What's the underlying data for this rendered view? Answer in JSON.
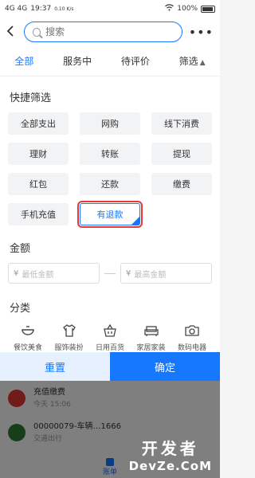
{
  "status": {
    "network": "4G 4G",
    "time": "19:37",
    "speed": "0.10 K/s",
    "battery": "100%"
  },
  "header": {
    "search_placeholder": "搜索",
    "more": "•••"
  },
  "tabs": [
    {
      "label": "全部"
    },
    {
      "label": "服务中"
    },
    {
      "label": "待评价"
    },
    {
      "label": "筛选"
    }
  ],
  "quick": {
    "title": "快捷筛选",
    "chips": [
      "全部支出",
      "网购",
      "线下消费",
      "理财",
      "转账",
      "提现",
      "红包",
      "还款",
      "缴费",
      "手机充值",
      "有退款"
    ]
  },
  "amount": {
    "title": "金额",
    "min_placeholder": "最低金额",
    "max_placeholder": "最高金额",
    "currency": "¥"
  },
  "category": {
    "title": "分类",
    "items": [
      {
        "label": "餐饮美食",
        "icon": "bowl-icon"
      },
      {
        "label": "服饰装扮",
        "icon": "shirt-icon"
      },
      {
        "label": "日用百货",
        "icon": "basket-icon"
      },
      {
        "label": "家居家装",
        "icon": "sofa-icon"
      },
      {
        "label": "数码电器",
        "icon": "camera-icon"
      }
    ]
  },
  "actions": {
    "reset": "重置",
    "confirm": "确定"
  },
  "background": {
    "row1": {
      "title": "充值缴费",
      "sub": "今天 15:06"
    },
    "row2": {
      "title": "00000079-车辆…1666",
      "sub": "交通出行"
    },
    "nav_active": "账单"
  },
  "watermark": {
    "line1": "开发者",
    "line2": "DevZe.CoM"
  },
  "colors": {
    "accent": "#1677ff",
    "highlight_box": "#e53935"
  }
}
